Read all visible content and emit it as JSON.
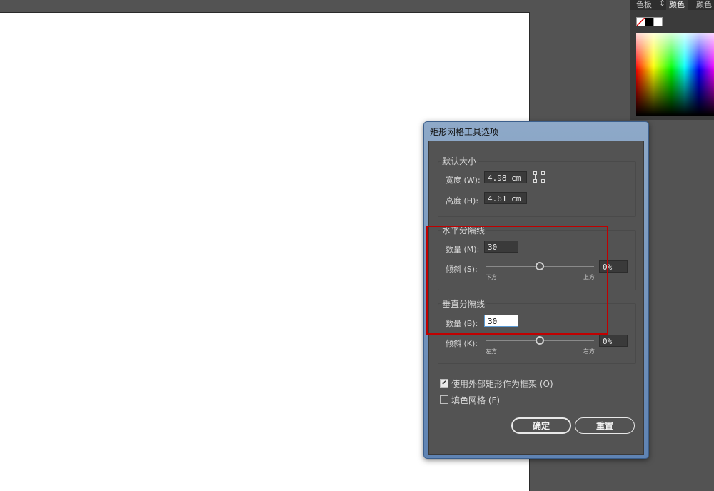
{
  "panel": {
    "tabs": [
      "色板",
      "颜色",
      "颜色"
    ],
    "active_tab": "颜色",
    "swap_arrow": "⇕"
  },
  "dialog": {
    "title": "矩形网格工具选项",
    "default_size": {
      "title": "默认大小",
      "width_label": "宽度 (W):",
      "width_value": "4.98 cm",
      "height_label": "高度 (H):",
      "height_value": "4.61 cm",
      "ref_icon": "reference-point-icon"
    },
    "horizontal": {
      "title": "水平分隔线",
      "count_label": "数量 (M):",
      "count_value": "30",
      "skew_label": "倾斜 (S):",
      "skew_value": "0%",
      "skew_level": 0,
      "left_tick": "下方",
      "right_tick": "上方"
    },
    "vertical": {
      "title": "垂直分隔线",
      "count_label": "数量 (B):",
      "count_value": "30",
      "skew_label": "倾斜 (K):",
      "skew_value": "0%",
      "skew_level": 0,
      "left_tick": "左方",
      "right_tick": "右方"
    },
    "use_outer_rect": {
      "label": "使用外部矩形作为框架 (O)",
      "checked": true
    },
    "fill_grid": {
      "label": "填色网格 (F)",
      "checked": false
    },
    "ok_label": "确定",
    "reset_label": "重置"
  },
  "colors": {
    "canvas": "#535353",
    "artboard": "#ffffff",
    "guide": "#b51b1b",
    "highlight": "#c00000"
  }
}
